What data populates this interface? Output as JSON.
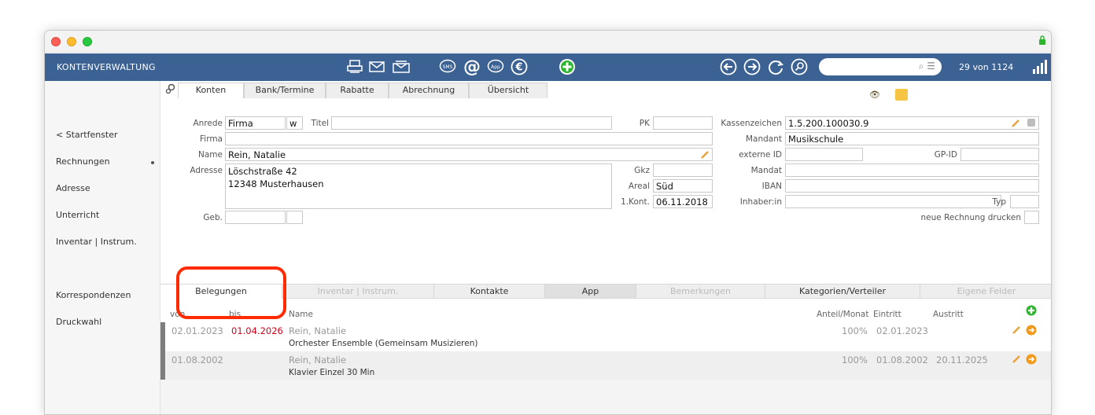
{
  "app": {
    "title": "KONTENVERWALTUNG",
    "counter": "29 von 1124"
  },
  "search": {
    "placeholder": ""
  },
  "sidebar": {
    "items": [
      {
        "label": "< Startfenster"
      },
      {
        "label": "Rechnungen"
      },
      {
        "label": "Adresse"
      },
      {
        "label": "Unterricht"
      },
      {
        "label": "Inventar | Instrum."
      },
      {
        "label": "Korrespondenzen"
      },
      {
        "label": "Druckwahl"
      }
    ]
  },
  "tabs": [
    {
      "label": "Konten"
    },
    {
      "label": "Bank/Termine"
    },
    {
      "label": "Rabatte"
    },
    {
      "label": "Abrechnung"
    },
    {
      "label": "Übersicht"
    }
  ],
  "form": {
    "anrede_label": "Anrede",
    "anrede_value": "Firma",
    "anrede_w": "w",
    "titel_label": "Titel",
    "titel_value": "",
    "firma_label": "Firma",
    "firma_value": "",
    "name_label": "Name",
    "name_value": "Rein, Natalie",
    "adresse_label": "Adresse",
    "adresse_value": "Löschstraße 42\n12348 Musterhausen",
    "geb_label": "Geb.",
    "geb_value": "",
    "pk_label": "PK",
    "pk_value": "",
    "gkz_label": "Gkz",
    "gkz_value": "",
    "areal_label": "Areal",
    "areal_value": "Süd",
    "kont_label": "1.Kont.",
    "kont_value": "06.11.2018",
    "kassenzeichen_label": "Kassenzeichen",
    "kassenzeichen_value": "1.5.200.100030.9",
    "mandant_label": "Mandant",
    "mandant_value": "Musikschule",
    "externe_id_label": "externe ID",
    "externe_id_value": "",
    "gpid_label": "GP-ID",
    "gpid_value": "",
    "mandat_label": "Mandat",
    "mandat_value": "",
    "iban_label": "IBAN",
    "iban_value": "",
    "inhaber_label": "Inhaber:in",
    "inhaber_value": "",
    "typ_label": "Typ",
    "typ_value": "",
    "neue_rechnung_label": "neue Rechnung drucken"
  },
  "bottom_tabs": [
    {
      "label": "Belegungen"
    },
    {
      "label": "Inventar | Instrum."
    },
    {
      "label": "Kontakte"
    },
    {
      "label": "App"
    },
    {
      "label": "Bemerkungen"
    },
    {
      "label": "Kategorien/Verteiler"
    },
    {
      "label": "Eigene Felder"
    }
  ],
  "table": {
    "headers": {
      "von": "von",
      "bis": "bis",
      "name": "Name",
      "anteil": "Anteil/Monat",
      "eintritt": "Eintritt",
      "austritt": "Austritt"
    },
    "rows": [
      {
        "von": "02.01.2023",
        "bis": "01.04.2026",
        "name": "Rein, Natalie",
        "course": "Orchester Ensemble (Gemeinsam Musizieren)",
        "anteil": "100%",
        "eintritt": "02.01.2023",
        "austritt": ""
      },
      {
        "von": "01.08.2002",
        "bis": "",
        "name": "Rein, Natalie",
        "course": "Klavier Einzel 30 Min",
        "anteil": "100%",
        "eintritt": "01.08.2002",
        "austritt": "20.11.2025"
      }
    ]
  },
  "colors": {
    "toolbar": "#3c6193",
    "highlight": "#ff2a00",
    "expired_date": "#d0021b",
    "add_green": "#2db52d",
    "goto_orange": "#f29a1c"
  }
}
